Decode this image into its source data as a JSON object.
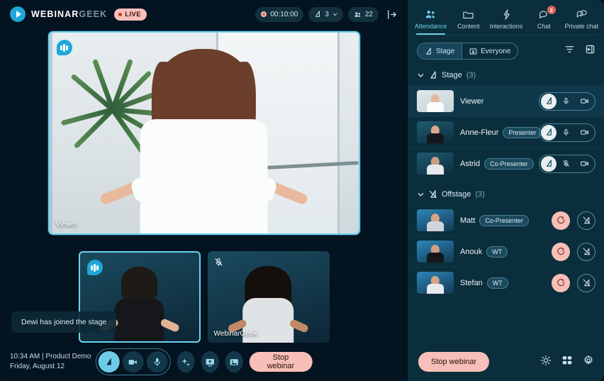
{
  "brand": {
    "name_bold": "WEBINAR",
    "name_dim": "GEEK",
    "live_label": "LIVE"
  },
  "topbar": {
    "timer": "00:10:00",
    "quality_value": "3",
    "attendees_count": "22",
    "leave_icon": "leave-icon"
  },
  "main_video": {
    "label": "Viewer",
    "speaking_badge": "speaking-indicator-icon"
  },
  "tiles": [
    {
      "label": "Dewi",
      "label_visible": "",
      "speaking": true,
      "muted": false,
      "active": true
    },
    {
      "label": "WebinarGeek",
      "label_visible": "WebinarGeek",
      "speaking": false,
      "muted": true,
      "active": false
    }
  ],
  "toast": {
    "message": "Dewi has joined the stage"
  },
  "session": {
    "line1": "10:34 AM | Product Demo",
    "line2": "Friday, August 12"
  },
  "controls": {
    "spotlight": "spotlight-icon",
    "camera": "camera-icon",
    "mic": "mic-icon",
    "effects": "sparkle-icon",
    "screenshare": "screen-share-icon",
    "background": "image-icon",
    "stop_label": "Stop webinar"
  },
  "bottom_right": {
    "stop_label": "Stop webinar",
    "brightness": "brightness-icon",
    "layout": "layout-grid-icon",
    "settings": "gear-icon"
  },
  "panel": {
    "tabs": [
      {
        "label": "Attendance",
        "icon": "attendance-icon",
        "active": true,
        "badge": ""
      },
      {
        "label": "Content",
        "icon": "folder-icon",
        "active": false,
        "badge": ""
      },
      {
        "label": "Interactions",
        "icon": "lightning-icon",
        "active": false,
        "badge": ""
      },
      {
        "label": "Chat",
        "icon": "chat-bubble-icon",
        "active": false,
        "badge": "2"
      },
      {
        "label": "Private chat",
        "icon": "private-chat-icon",
        "active": false,
        "badge": ""
      }
    ],
    "segments": [
      {
        "label": "Stage",
        "icon": "spotlight-icon",
        "active": true
      },
      {
        "label": "Everyone",
        "icon": "grid-people-icon",
        "active": false
      }
    ],
    "filter_icon": "filter-icon",
    "collapse_icon": "collapse-panel-icon",
    "groups": [
      {
        "title": "Stage",
        "count": "(3)",
        "icon": "spotlight-icon",
        "rows": [
          {
            "name": "Viewer",
            "role": "",
            "highlighted": true,
            "spotlight_on": true,
            "mic_muted": false,
            "camera_on": true,
            "thumb": "light"
          },
          {
            "name": "Anne-Fleur",
            "role": "Presenter",
            "highlighted": false,
            "spotlight_on": true,
            "mic_muted": false,
            "camera_on": true,
            "thumb": "dark"
          },
          {
            "name": "Astrid",
            "role": "Co-Presenter",
            "highlighted": false,
            "spotlight_on": true,
            "mic_muted": true,
            "camera_on": true,
            "thumb": "dark"
          }
        ]
      },
      {
        "title": "Offstage",
        "count": "(3)",
        "icon": "offstage-icon",
        "rows": [
          {
            "name": "Matt",
            "role": "Co-Presenter",
            "invite_icon": "invite-to-stage-icon",
            "remove_icon": "offstage-icon",
            "thumb": "blue"
          },
          {
            "name": "Anouk",
            "role": "WT",
            "invite_icon": "invite-to-stage-icon",
            "remove_icon": "offstage-icon",
            "thumb": "blue"
          },
          {
            "name": "Stefan",
            "role": "WT",
            "invite_icon": "invite-to-stage-icon",
            "remove_icon": "offstage-icon",
            "thumb": "blue"
          }
        ]
      }
    ]
  },
  "colors": {
    "accent_cyan": "#6ecbe8",
    "salmon": "#f7bfb7",
    "panel_bg": "#0b2e3c",
    "stage_bg": "#041320",
    "badge_red": "#e4655a"
  }
}
